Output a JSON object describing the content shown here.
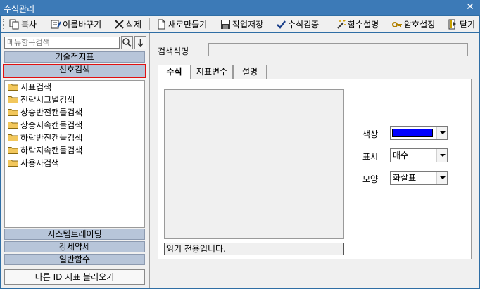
{
  "window": {
    "title": "수식관리",
    "close_glyph": "✕"
  },
  "toolbar": {
    "copy": "복사",
    "rename": "이름바꾸기",
    "delete": "삭제",
    "new": "새로만들기",
    "save": "작업저장",
    "verify": "수식검증",
    "func_help": "함수설명",
    "password": "암호설정",
    "close": "닫기"
  },
  "search": {
    "placeholder": "메뉴항목검색",
    "search_glyph": "🔍",
    "down_glyph": "↓"
  },
  "categories": {
    "tech_index": "기술적지표",
    "signal_search": "신호검색",
    "system_trading": "시스템트레이딩",
    "strength": "강세약세",
    "general_func": "일반함수"
  },
  "tree": [
    "지표검색",
    "전략시그널검색",
    "상승반전캔들검색",
    "상승지속캔들검색",
    "하락반전캔들검색",
    "하락지속캔들검색",
    "사용자검색"
  ],
  "load_button": "다른 ID 지표 불러오기",
  "main": {
    "search_name_label": "검색식명",
    "search_name_value": "",
    "tabs": [
      "수식",
      "지표변수",
      "설명"
    ],
    "status_text": "읽기 전용입니다.",
    "color_label": "색상",
    "color_value": "#0000ff",
    "display_label": "표시",
    "display_value": "매수",
    "shape_label": "모양",
    "shape_value": "화살표"
  },
  "colors": {
    "title_bar": "#3c7ab7",
    "category_bg": "#b7c5d9",
    "highlight": "#e01010",
    "folder": "#f2c75c"
  }
}
